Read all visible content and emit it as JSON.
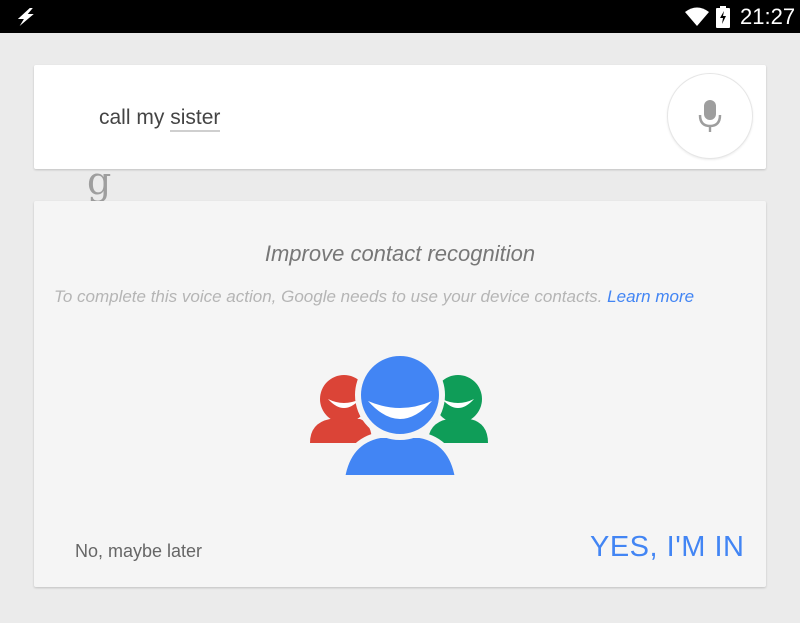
{
  "status_bar": {
    "time": "21:27",
    "icons": [
      "flash-icon",
      "wifi-icon",
      "battery-charging-icon"
    ]
  },
  "search": {
    "logo_letter": "g",
    "query_prefix": "call my ",
    "query_highlight": "sister",
    "mic_icon": "microphone-icon"
  },
  "consent_card": {
    "title": "Improve contact recognition",
    "description": "To complete this voice action, Google needs to use your device contacts.",
    "learn_more_label": "Learn more",
    "decline_label": "No, maybe later",
    "accept_label": "YES, I'M IN",
    "illustration_icon": "contacts-group-icon"
  },
  "colors": {
    "accent_blue": "#4285f4",
    "contact_red": "#db4437",
    "contact_green": "#0f9d58",
    "contact_blue": "#4285f4"
  }
}
